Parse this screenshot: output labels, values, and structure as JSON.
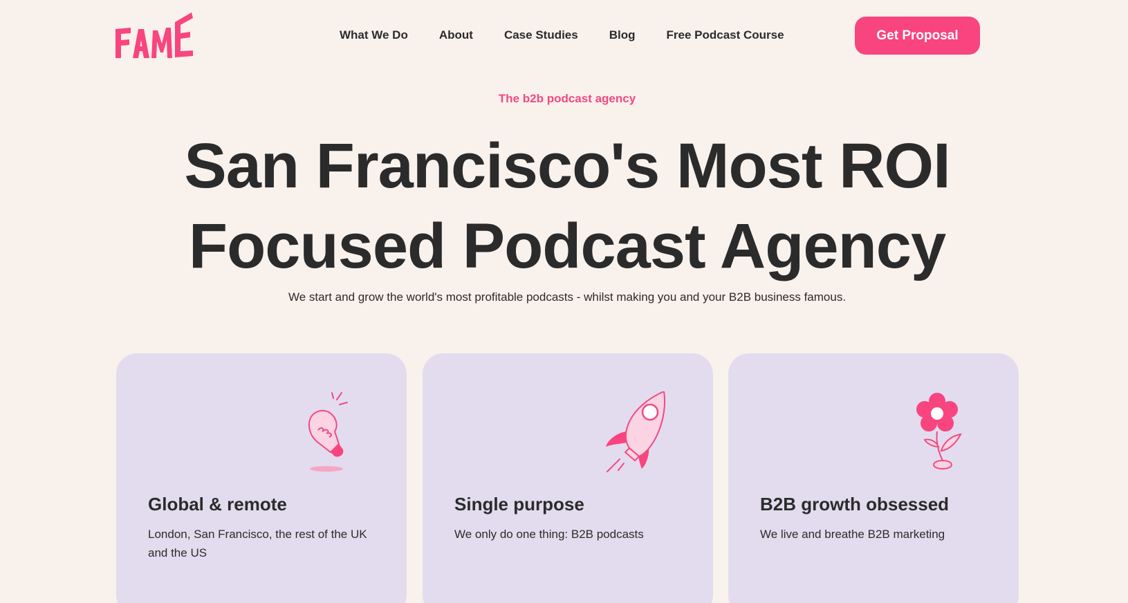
{
  "header": {
    "logo_text": "FAME",
    "nav": [
      {
        "label": "What We Do"
      },
      {
        "label": "About"
      },
      {
        "label": "Case Studies"
      },
      {
        "label": "Blog"
      },
      {
        "label": "Free Podcast Course"
      }
    ],
    "cta_label": "Get Proposal"
  },
  "hero": {
    "eyebrow": "The b2b podcast agency",
    "headline_line1": "San Francisco's Most ROI",
    "headline_line2": "Focused Podcast Agency",
    "subline": "We start and grow the world's most profitable podcasts - whilst making you and your B2B business famous."
  },
  "features": [
    {
      "icon": "lightbulb-icon",
      "title": "Global & remote",
      "text": "London, San Francisco, the rest of the UK and the US"
    },
    {
      "icon": "rocket-icon",
      "title": "Single purpose",
      "text": "We only do one thing: B2B podcasts"
    },
    {
      "icon": "flower-icon",
      "title": "B2B growth obsessed",
      "text": "We live and breathe B2B marketing"
    }
  ],
  "colors": {
    "accent": "#f8457f",
    "background": "#f9f1ec",
    "card": "#e2dcee",
    "text": "#2b2b2b"
  }
}
